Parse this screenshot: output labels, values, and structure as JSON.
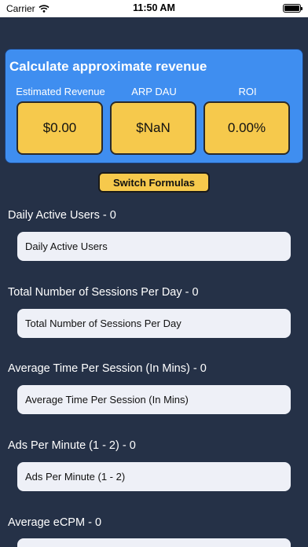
{
  "status_bar": {
    "carrier": "Carrier",
    "time": "11:50 AM"
  },
  "revenue": {
    "title": "Calculate approximate revenue",
    "metrics": [
      {
        "label": "Estimated Revenue",
        "value": "$0.00"
      },
      {
        "label": "ARP DAU",
        "value": "$NaN"
      },
      {
        "label": "ROI",
        "value": "0.00%"
      }
    ]
  },
  "switch_button_label": "Switch Formulas",
  "fields": [
    {
      "label": "Daily Active Users - 0",
      "placeholder": "Daily Active Users"
    },
    {
      "label": "Total Number of Sessions Per Day - 0",
      "placeholder": "Total Number of Sessions Per Day"
    },
    {
      "label": "Average Time Per Session (In Mins) - 0",
      "placeholder": "Average Time Per Session (In Mins)"
    },
    {
      "label": "Ads Per Minute (1 - 2) - 0",
      "placeholder": "Ads Per Minute (1 - 2)"
    },
    {
      "label": "Average eCPM - 0",
      "placeholder": ""
    }
  ],
  "colors": {
    "background": "#253147",
    "panel": "#3f8ef0",
    "accent_yellow": "#f6c94c",
    "input_bg": "#eef0f7"
  }
}
